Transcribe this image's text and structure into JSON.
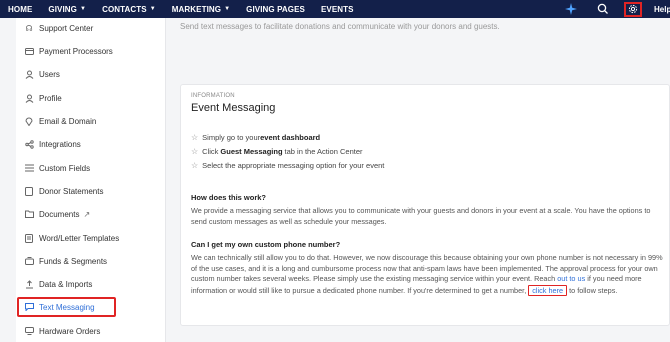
{
  "nav": {
    "items": [
      {
        "label": "HOME",
        "has_dropdown": false
      },
      {
        "label": "GIVING",
        "has_dropdown": true
      },
      {
        "label": "CONTACTS",
        "has_dropdown": true
      },
      {
        "label": "MARKETING",
        "has_dropdown": true
      },
      {
        "label": "GIVING PAGES",
        "has_dropdown": false
      },
      {
        "label": "EVENTS",
        "has_dropdown": false
      }
    ],
    "help_label": "Help",
    "ai_icon": "sparkle-icon",
    "search_icon": "search-icon",
    "settings_icon": "gear-icon"
  },
  "sidebar": {
    "items": [
      {
        "label": "Support Center",
        "icon": "headset-icon",
        "active": false
      },
      {
        "label": "Payment Processors",
        "icon": "card-icon",
        "active": false
      },
      {
        "label": "Users",
        "icon": "user-icon",
        "active": false
      },
      {
        "label": "Profile",
        "icon": "profile-icon",
        "active": false
      },
      {
        "label": "Email & Domain",
        "icon": "pin-icon",
        "active": false
      },
      {
        "label": "Integrations",
        "icon": "share-icon",
        "active": false
      },
      {
        "label": "Custom Fields",
        "icon": "list-icon",
        "active": false
      },
      {
        "label": "Donor Statements",
        "icon": "document-icon",
        "active": false
      },
      {
        "label": "Documents",
        "icon": "folder-icon",
        "active": false,
        "external": true
      },
      {
        "label": "Word/Letter Templates",
        "icon": "template-icon",
        "active": false
      },
      {
        "label": "Funds & Segments",
        "icon": "funds-icon",
        "active": false
      },
      {
        "label": "Data & Imports",
        "icon": "upload-icon",
        "active": false
      },
      {
        "label": "Text Messaging",
        "icon": "message-icon",
        "active": true
      },
      {
        "label": "Hardware Orders",
        "icon": "hardware-icon",
        "active": false
      }
    ]
  },
  "main": {
    "intro_text": "Send text messages to facilitate donations and communicate with your donors and guests.",
    "card": {
      "eyebrow": "INFORMATION",
      "title": "Event Messaging",
      "steps": [
        {
          "pre": "Simply go to your ",
          "bold": "event dashboard",
          "post": ""
        },
        {
          "pre": "Click ",
          "bold": "Guest Messaging",
          "post": " tab in the Action Center"
        },
        {
          "pre": "Select the appropriate messaging option for your event",
          "bold": "",
          "post": ""
        }
      ],
      "q1": "How does this work?",
      "a1": "We provide a messaging service that allows you to communicate with your guests and donors in your event at a scale. You have the options to send custom messages as well as schedule your messages.",
      "q2": "Can I get my own custom phone number?",
      "a2_part1": "We can technically still allow you to do that. However, we now discourage this because obtaining your own phone number is not necessary in 99% of the use cases, and it is a long and cumbursome process now that anti-spam laws have been implemented. The approval process for your own custom number takes several weeks. Please simply use the existing messaging service within your event. Reach ",
      "a2_link1": "out to us",
      "a2_part2": " if you need more information or would still like to pursue a dedicated phone number. If you're determined to get a number, ",
      "a2_link2": "click here",
      "a2_part3": " to follow steps."
    }
  }
}
